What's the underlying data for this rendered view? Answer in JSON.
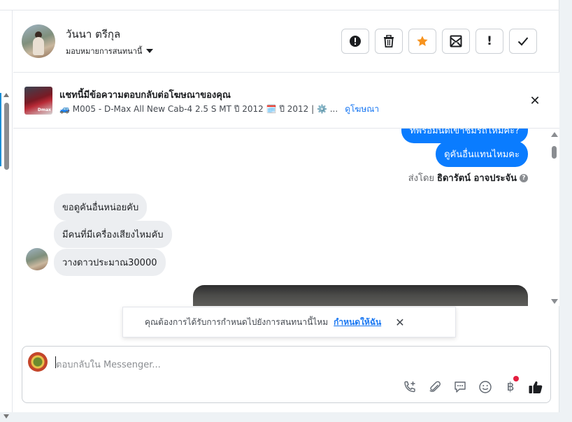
{
  "header": {
    "contact_name": "วันนา ตรีกุล",
    "assign_label": "มอบหมายการสนทนานี้",
    "buttons": [
      {
        "icon": "alert-circle-icon"
      },
      {
        "icon": "trash-icon"
      },
      {
        "icon": "star-icon"
      },
      {
        "icon": "mark-unread-icon"
      },
      {
        "icon": "exclamation-icon"
      },
      {
        "icon": "check-icon"
      }
    ]
  },
  "ad": {
    "title": "แชทนี้มีข้อความตอบกลับต่อโฆษณาของคุณ",
    "detail": "🚙 M005 - D-Max All New Cab-4 2.5 S MT ปี 2012 🗓️ ปี 2012 | ⚙️ ...",
    "link": "ดูโฆษณา",
    "thumb_tag": "Dmax"
  },
  "messages": {
    "outgoing_top_partial": "ทีพร้อมนัดเข้าชมรถไหมคะ?",
    "outgoing": "ดูคันอื่นแทนไหมคะ",
    "sent_by_prefix": "ส่งโดย",
    "sent_by_name": "ธิดารัตน์ อาจประจัน",
    "incoming": [
      "ขอดูคันอื่นหน่อยคับ",
      "มีคนที่มีเครื่องเสียงไหมคับ",
      "วางดาวประมาณ30000"
    ]
  },
  "toast": {
    "text": "คุณต้องการได้รับการกำหนดไปยังการสนทนานี้ไหม",
    "action": "กำหนดให้ฉัน"
  },
  "composer": {
    "placeholder": "ตอบกลับใน Messenger...",
    "tools": [
      "add-call-icon",
      "attachment-icon",
      "saved-reply-icon",
      "emoji-icon",
      "baht-payment-icon",
      "thumbs-up-icon"
    ]
  },
  "colors": {
    "accent": "#0a7cff",
    "link": "#1877f2",
    "star": "#f7931e",
    "notification_dot": "#e41e3f"
  }
}
